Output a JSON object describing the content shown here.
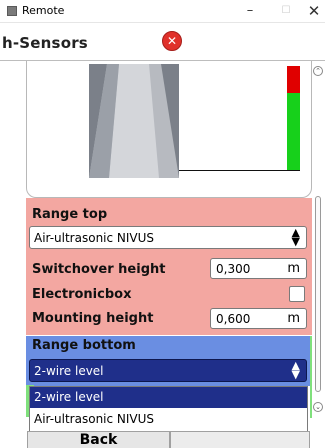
{
  "window": {
    "title": "Remote"
  },
  "header": {
    "title": "h-Sensors"
  },
  "level": {
    "fill_fraction": 0.74
  },
  "range_top": {
    "label": "Range top",
    "sensor_value": "Air-ultrasonic NIVUS"
  },
  "switchover": {
    "label": "Switchover height",
    "value": "0,300",
    "unit": "m"
  },
  "electronicbox": {
    "label": "Electronicbox",
    "checked": false
  },
  "mounting": {
    "label": "Mounting height",
    "value": "0,600",
    "unit": "m"
  },
  "range_bottom": {
    "label": "Range bottom",
    "sensor_value": "2-wire level",
    "options": [
      "2-wire level",
      "Air-ultrasonic NIVUS"
    ]
  },
  "footer": {
    "back_label": "Back"
  },
  "colors": {
    "range_top_bg": "#f3a7a1",
    "range_bottom_bg": "#6a8ee2",
    "level_high": "#e00000",
    "level_fill": "#17d01b",
    "selection": "#1f2f8a"
  }
}
